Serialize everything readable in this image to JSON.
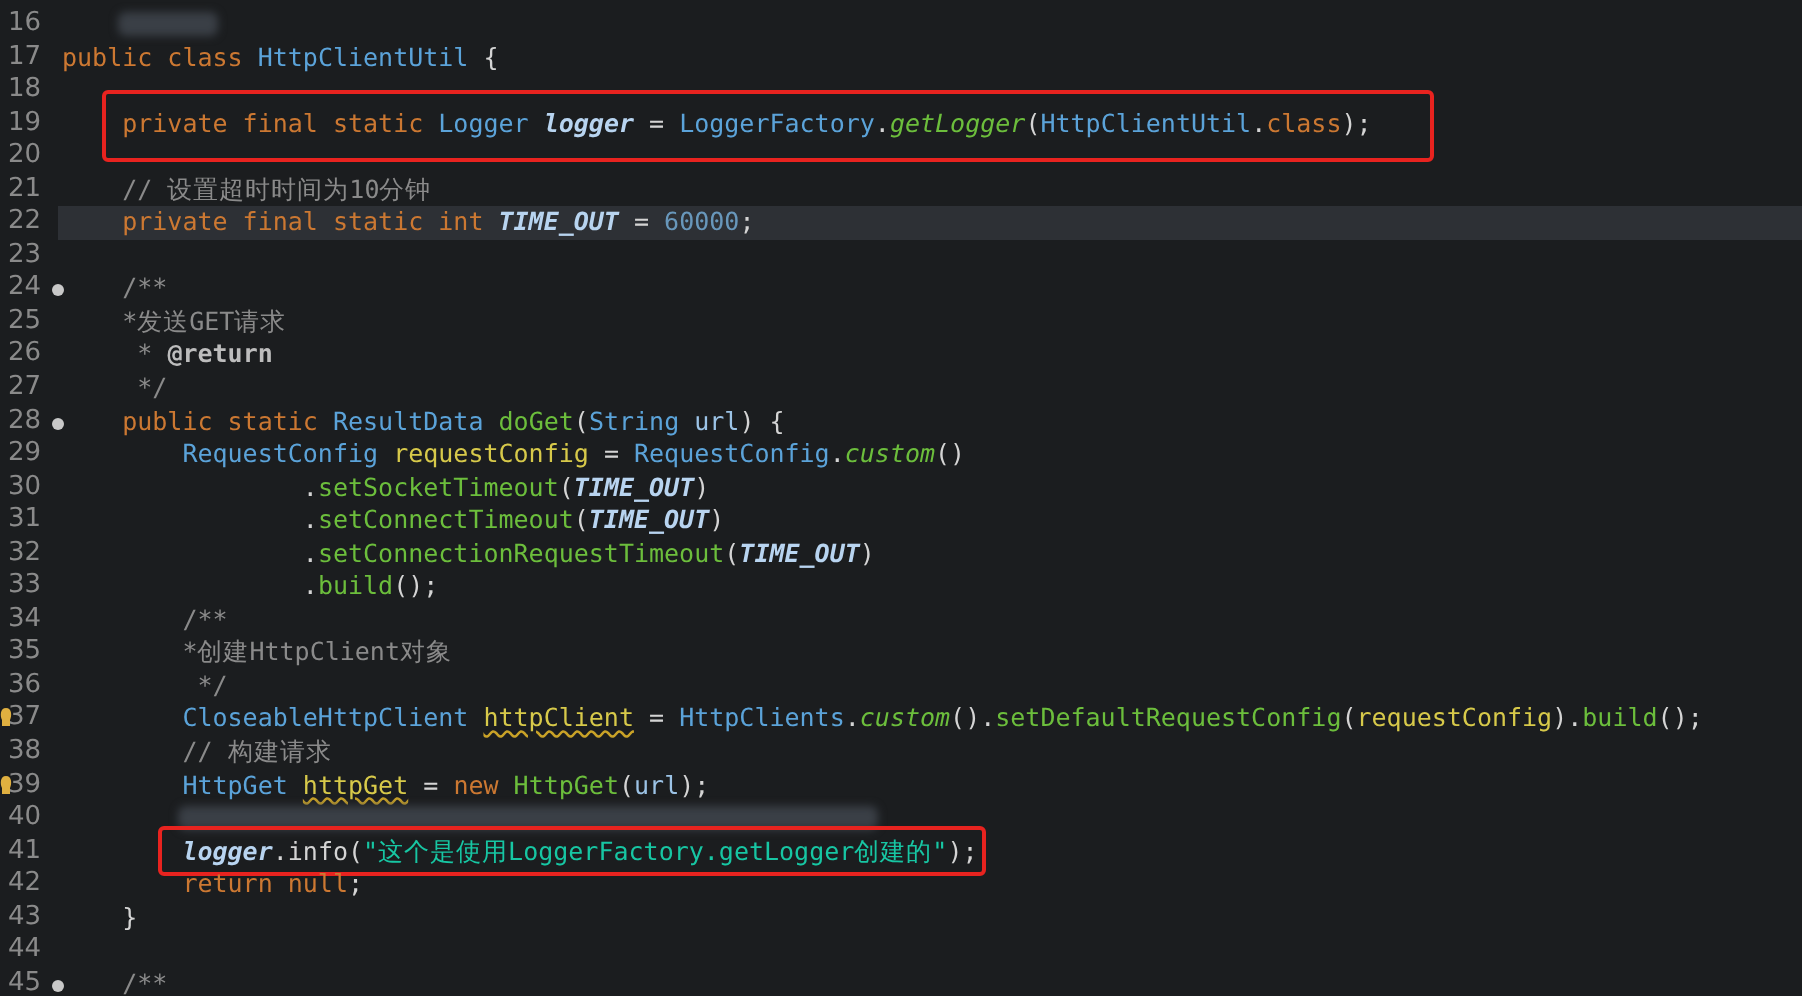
{
  "lines": [
    {
      "number": "16",
      "redacted": true
    },
    {
      "number": "17",
      "tokens": [
        {
          "text": "public class ",
          "kind": "keyword"
        },
        {
          "text": "HttpClientUtil",
          "kind": "type"
        },
        {
          "text": " {",
          "kind": "plain"
        }
      ]
    },
    {
      "number": "18"
    },
    {
      "number": "19",
      "boxed": true,
      "tokens": [
        {
          "text": "    private final static ",
          "kind": "keyword"
        },
        {
          "text": "Logger ",
          "kind": "type"
        },
        {
          "text": "logger",
          "kind": "static-field"
        },
        {
          "text": " = ",
          "kind": "plain"
        },
        {
          "text": "LoggerFactory",
          "kind": "type"
        },
        {
          "text": ".",
          "kind": "plain"
        },
        {
          "text": "getLogger",
          "kind": "static-method"
        },
        {
          "text": "(",
          "kind": "plain"
        },
        {
          "text": "HttpClientUtil",
          "kind": "type"
        },
        {
          "text": ".",
          "kind": "plain"
        },
        {
          "text": "class",
          "kind": "keyword"
        },
        {
          "text": ");",
          "kind": "plain"
        }
      ]
    },
    {
      "number": "20"
    },
    {
      "number": "21",
      "tokens": [
        {
          "text": "    // 设置超时时间为10分钟",
          "kind": "comment"
        }
      ]
    },
    {
      "number": "22",
      "current": true,
      "tokens": [
        {
          "text": "    private final static int ",
          "kind": "keyword"
        },
        {
          "text": "TIME_OUT",
          "kind": "static-field"
        },
        {
          "text": " = ",
          "kind": "plain"
        },
        {
          "text": "60000",
          "kind": "number"
        },
        {
          "text": ";",
          "kind": "plain"
        }
      ]
    },
    {
      "number": "23"
    },
    {
      "number": "24",
      "fold_marker": true,
      "tokens": [
        {
          "text": "    /**",
          "kind": "comment"
        }
      ]
    },
    {
      "number": "25",
      "tokens": [
        {
          "text": "    *发送GET请求",
          "kind": "comment"
        }
      ]
    },
    {
      "number": "26",
      "tokens": [
        {
          "text": "     * ",
          "kind": "comment"
        },
        {
          "text": "@return",
          "kind": "doc-tag"
        }
      ]
    },
    {
      "number": "27",
      "tokens": [
        {
          "text": "     */",
          "kind": "comment"
        }
      ]
    },
    {
      "number": "28",
      "fold_marker": true,
      "tokens": [
        {
          "text": "    public static ",
          "kind": "keyword"
        },
        {
          "text": "ResultData ",
          "kind": "type"
        },
        {
          "text": "doGet",
          "kind": "method"
        },
        {
          "text": "(",
          "kind": "plain"
        },
        {
          "text": "String ",
          "kind": "type"
        },
        {
          "text": "url",
          "kind": "param"
        },
        {
          "text": ") {",
          "kind": "plain"
        }
      ]
    },
    {
      "number": "29",
      "tokens": [
        {
          "text": "        RequestConfig ",
          "kind": "type"
        },
        {
          "text": "requestConfig",
          "kind": "local"
        },
        {
          "text": " = ",
          "kind": "plain"
        },
        {
          "text": "RequestConfig",
          "kind": "type"
        },
        {
          "text": ".",
          "kind": "plain"
        },
        {
          "text": "custom",
          "kind": "static-method"
        },
        {
          "text": "()",
          "kind": "plain"
        }
      ]
    },
    {
      "number": "30",
      "tokens": [
        {
          "text": "                .",
          "kind": "plain"
        },
        {
          "text": "setSocketTimeout",
          "kind": "method"
        },
        {
          "text": "(",
          "kind": "plain"
        },
        {
          "text": "TIME_OUT",
          "kind": "static-field"
        },
        {
          "text": ")",
          "kind": "plain"
        }
      ]
    },
    {
      "number": "31",
      "tokens": [
        {
          "text": "                .",
          "kind": "plain"
        },
        {
          "text": "setConnectTimeout",
          "kind": "method"
        },
        {
          "text": "(",
          "kind": "plain"
        },
        {
          "text": "TIME_OUT",
          "kind": "static-field"
        },
        {
          "text": ")",
          "kind": "plain"
        }
      ]
    },
    {
      "number": "32",
      "tokens": [
        {
          "text": "                .",
          "kind": "plain"
        },
        {
          "text": "setConnectionRequestTimeout",
          "kind": "method"
        },
        {
          "text": "(",
          "kind": "plain"
        },
        {
          "text": "TIME_OUT",
          "kind": "static-field"
        },
        {
          "text": ")",
          "kind": "plain"
        }
      ]
    },
    {
      "number": "33",
      "tokens": [
        {
          "text": "                .",
          "kind": "plain"
        },
        {
          "text": "build",
          "kind": "method"
        },
        {
          "text": "();",
          "kind": "plain"
        }
      ]
    },
    {
      "number": "34",
      "tokens": [
        {
          "text": "        /**",
          "kind": "comment"
        }
      ]
    },
    {
      "number": "35",
      "tokens": [
        {
          "text": "        *创建HttpClient对象",
          "kind": "comment"
        }
      ]
    },
    {
      "number": "36",
      "tokens": [
        {
          "text": "         */",
          "kind": "comment"
        }
      ]
    },
    {
      "number": "37",
      "warning": true,
      "tokens": [
        {
          "text": "        CloseableHttpClient ",
          "kind": "type"
        },
        {
          "text": "httpClient",
          "kind": "local-warning"
        },
        {
          "text": " = ",
          "kind": "plain"
        },
        {
          "text": "HttpClients",
          "kind": "type"
        },
        {
          "text": ".",
          "kind": "plain"
        },
        {
          "text": "custom",
          "kind": "static-method"
        },
        {
          "text": "().",
          "kind": "plain"
        },
        {
          "text": "setDefaultRequestConfig",
          "kind": "method"
        },
        {
          "text": "(",
          "kind": "plain"
        },
        {
          "text": "requestConfig",
          "kind": "local"
        },
        {
          "text": ").",
          "kind": "plain"
        },
        {
          "text": "build",
          "kind": "method"
        },
        {
          "text": "();",
          "kind": "plain"
        }
      ]
    },
    {
      "number": "38",
      "tokens": [
        {
          "text": "        // 构建请求",
          "kind": "comment"
        }
      ]
    },
    {
      "number": "39",
      "warning": true,
      "tokens": [
        {
          "text": "        HttpGet ",
          "kind": "type"
        },
        {
          "text": "httpGet",
          "kind": "local-warning"
        },
        {
          "text": " = ",
          "kind": "plain"
        },
        {
          "text": "new ",
          "kind": "keyword"
        },
        {
          "text": "HttpGet",
          "kind": "method"
        },
        {
          "text": "(",
          "kind": "plain"
        },
        {
          "text": "url",
          "kind": "param"
        },
        {
          "text": ");",
          "kind": "plain"
        }
      ]
    },
    {
      "number": "40",
      "redacted": true
    },
    {
      "number": "41",
      "boxed": true,
      "tokens": [
        {
          "text": "        logger",
          "kind": "static-field"
        },
        {
          "text": ".",
          "kind": "plain"
        },
        {
          "text": "info",
          "kind": "plain"
        },
        {
          "text": "(",
          "kind": "plain"
        },
        {
          "text": "\"这个是使用LoggerFactory.getLogger创建的\"",
          "kind": "string"
        },
        {
          "text": ");",
          "kind": "plain"
        }
      ]
    },
    {
      "number": "42",
      "tokens": [
        {
          "text": "        return null",
          "kind": "keyword"
        },
        {
          "text": ";",
          "kind": "plain"
        }
      ]
    },
    {
      "number": "43",
      "tokens": [
        {
          "text": "    }",
          "kind": "plain"
        }
      ]
    },
    {
      "number": "44"
    },
    {
      "number": "45",
      "fold_marker": true,
      "tokens": [
        {
          "text": "    /**",
          "kind": "comment"
        }
      ]
    }
  ]
}
